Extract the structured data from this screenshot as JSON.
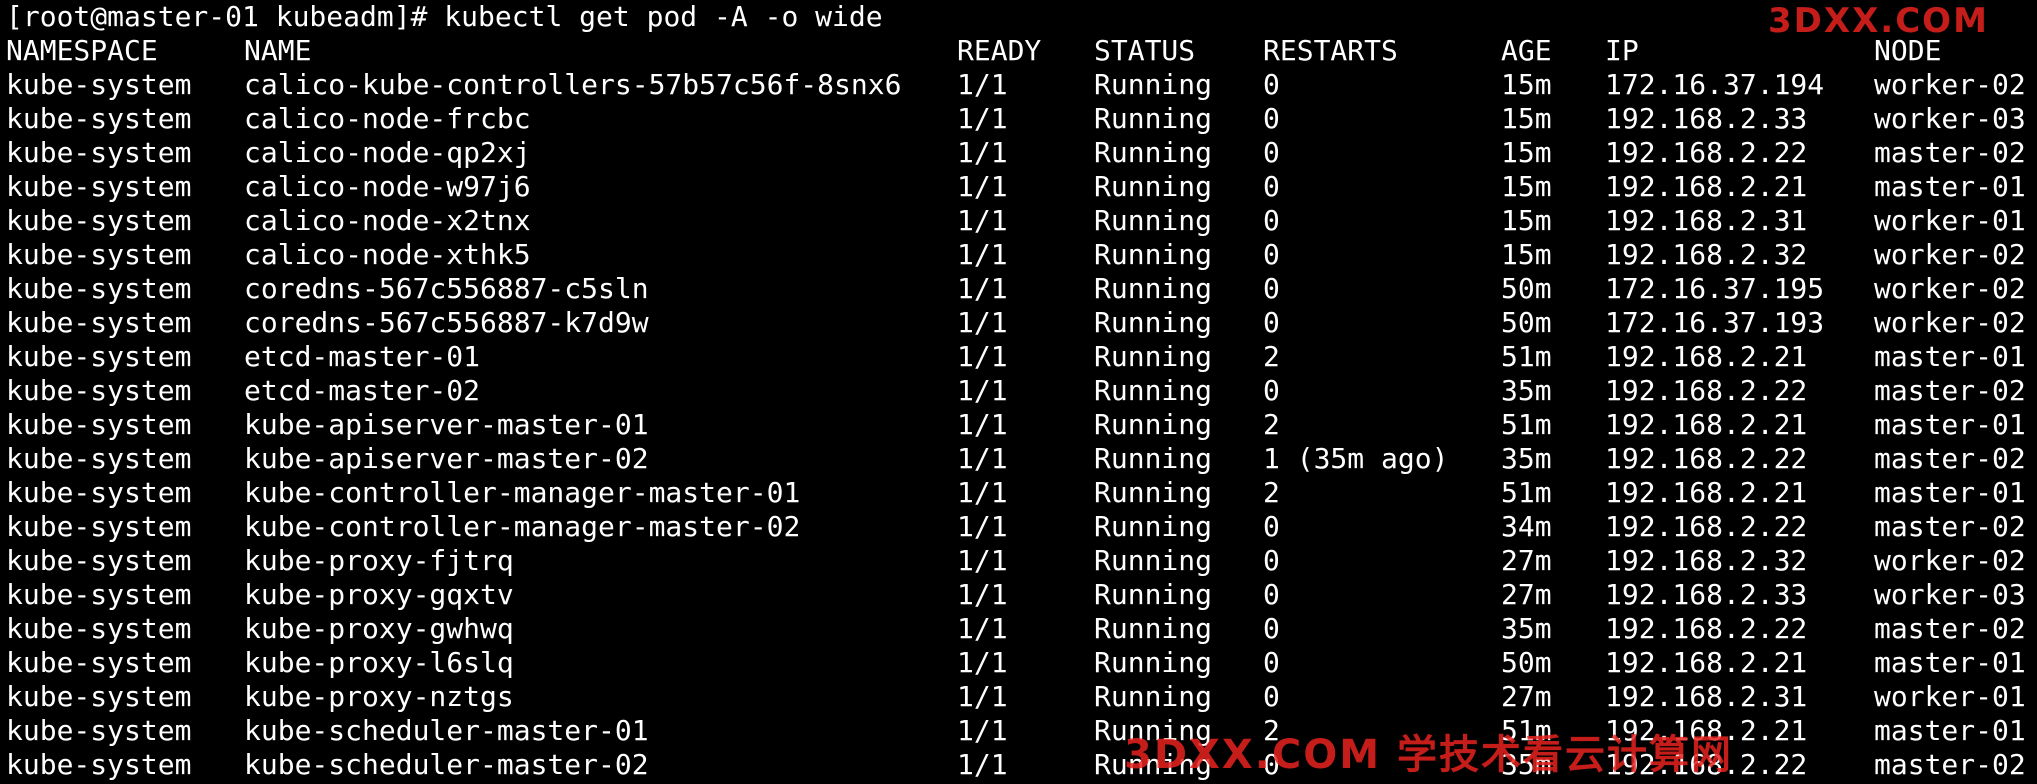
{
  "terminal": {
    "prompt": "[root@master-01 kubeadm]# kubectl get pod -A -o wide",
    "headers": {
      "namespace": "NAMESPACE",
      "name": "NAME",
      "ready": "READY",
      "status": "STATUS",
      "restarts": "RESTARTS",
      "age": "AGE",
      "ip": "IP",
      "node": "NODE"
    },
    "rows": [
      {
        "namespace": "kube-system",
        "name": "calico-kube-controllers-57b57c56f-8snx6",
        "ready": "1/1",
        "status": "Running",
        "restarts": "0",
        "age": "15m",
        "ip": "172.16.37.194",
        "node": "worker-02"
      },
      {
        "namespace": "kube-system",
        "name": "calico-node-frcbc",
        "ready": "1/1",
        "status": "Running",
        "restarts": "0",
        "age": "15m",
        "ip": "192.168.2.33",
        "node": "worker-03"
      },
      {
        "namespace": "kube-system",
        "name": "calico-node-qp2xj",
        "ready": "1/1",
        "status": "Running",
        "restarts": "0",
        "age": "15m",
        "ip": "192.168.2.22",
        "node": "master-02"
      },
      {
        "namespace": "kube-system",
        "name": "calico-node-w97j6",
        "ready": "1/1",
        "status": "Running",
        "restarts": "0",
        "age": "15m",
        "ip": "192.168.2.21",
        "node": "master-01"
      },
      {
        "namespace": "kube-system",
        "name": "calico-node-x2tnx",
        "ready": "1/1",
        "status": "Running",
        "restarts": "0",
        "age": "15m",
        "ip": "192.168.2.31",
        "node": "worker-01"
      },
      {
        "namespace": "kube-system",
        "name": "calico-node-xthk5",
        "ready": "1/1",
        "status": "Running",
        "restarts": "0",
        "age": "15m",
        "ip": "192.168.2.32",
        "node": "worker-02"
      },
      {
        "namespace": "kube-system",
        "name": "coredns-567c556887-c5sln",
        "ready": "1/1",
        "status": "Running",
        "restarts": "0",
        "age": "50m",
        "ip": "172.16.37.195",
        "node": "worker-02"
      },
      {
        "namespace": "kube-system",
        "name": "coredns-567c556887-k7d9w",
        "ready": "1/1",
        "status": "Running",
        "restarts": "0",
        "age": "50m",
        "ip": "172.16.37.193",
        "node": "worker-02"
      },
      {
        "namespace": "kube-system",
        "name": "etcd-master-01",
        "ready": "1/1",
        "status": "Running",
        "restarts": "2",
        "age": "51m",
        "ip": "192.168.2.21",
        "node": "master-01"
      },
      {
        "namespace": "kube-system",
        "name": "etcd-master-02",
        "ready": "1/1",
        "status": "Running",
        "restarts": "0",
        "age": "35m",
        "ip": "192.168.2.22",
        "node": "master-02"
      },
      {
        "namespace": "kube-system",
        "name": "kube-apiserver-master-01",
        "ready": "1/1",
        "status": "Running",
        "restarts": "2",
        "age": "51m",
        "ip": "192.168.2.21",
        "node": "master-01"
      },
      {
        "namespace": "kube-system",
        "name": "kube-apiserver-master-02",
        "ready": "1/1",
        "status": "Running",
        "restarts": "1 (35m ago)",
        "age": "35m",
        "ip": "192.168.2.22",
        "node": "master-02"
      },
      {
        "namespace": "kube-system",
        "name": "kube-controller-manager-master-01",
        "ready": "1/1",
        "status": "Running",
        "restarts": "2",
        "age": "51m",
        "ip": "192.168.2.21",
        "node": "master-01"
      },
      {
        "namespace": "kube-system",
        "name": "kube-controller-manager-master-02",
        "ready": "1/1",
        "status": "Running",
        "restarts": "0",
        "age": "34m",
        "ip": "192.168.2.22",
        "node": "master-02"
      },
      {
        "namespace": "kube-system",
        "name": "kube-proxy-fjtrq",
        "ready": "1/1",
        "status": "Running",
        "restarts": "0",
        "age": "27m",
        "ip": "192.168.2.32",
        "node": "worker-02"
      },
      {
        "namespace": "kube-system",
        "name": "kube-proxy-gqxtv",
        "ready": "1/1",
        "status": "Running",
        "restarts": "0",
        "age": "27m",
        "ip": "192.168.2.33",
        "node": "worker-03"
      },
      {
        "namespace": "kube-system",
        "name": "kube-proxy-gwhwq",
        "ready": "1/1",
        "status": "Running",
        "restarts": "0",
        "age": "35m",
        "ip": "192.168.2.22",
        "node": "master-02"
      },
      {
        "namespace": "kube-system",
        "name": "kube-proxy-l6slq",
        "ready": "1/1",
        "status": "Running",
        "restarts": "0",
        "age": "50m",
        "ip": "192.168.2.21",
        "node": "master-01"
      },
      {
        "namespace": "kube-system",
        "name": "kube-proxy-nztgs",
        "ready": "1/1",
        "status": "Running",
        "restarts": "0",
        "age": "27m",
        "ip": "192.168.2.31",
        "node": "worker-01"
      },
      {
        "namespace": "kube-system",
        "name": "kube-scheduler-master-01",
        "ready": "1/1",
        "status": "Running",
        "restarts": "2",
        "age": "51m",
        "ip": "192.168.2.21",
        "node": "master-01"
      },
      {
        "namespace": "kube-system",
        "name": "kube-scheduler-master-02",
        "ready": "1/1",
        "status": "Running",
        "restarts": "0",
        "age": "35m",
        "ip": "192.168.2.22",
        "node": "master-02"
      }
    ]
  },
  "watermarks": {
    "top": "3DXX.COM",
    "bottom": "3DXX.COM 学技术看云计算网"
  },
  "colors": {
    "background": "#000000",
    "text": "#ffffff",
    "watermark": "#e8231f"
  }
}
